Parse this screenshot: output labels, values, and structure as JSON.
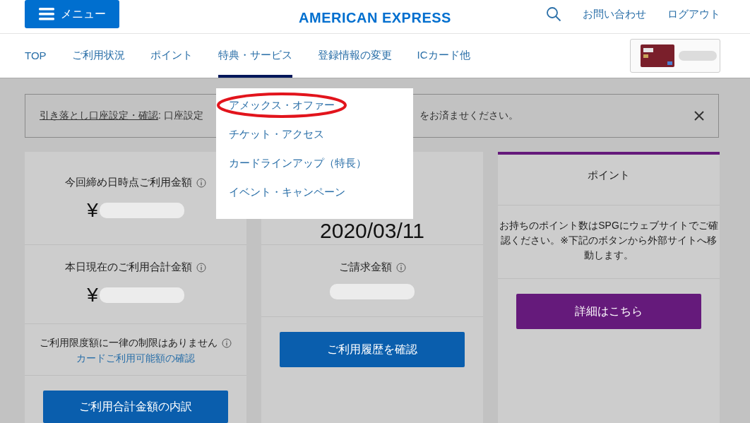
{
  "header": {
    "menu_button": "メニュー",
    "logo": "AMERICAN EXPRESS",
    "links": [
      "お問い合わせ",
      "ログアウト"
    ]
  },
  "nav": {
    "items": [
      {
        "label": "TOP",
        "selected": false
      },
      {
        "label": "ご利用状況",
        "selected": false
      },
      {
        "label": "ポイント",
        "selected": false
      },
      {
        "label": "特典・サービス",
        "selected": true
      },
      {
        "label": "登録情報の変更",
        "selected": false
      },
      {
        "label": "ICカード他",
        "selected": false
      }
    ]
  },
  "dropdown": {
    "items": [
      {
        "label": "アメックス・オファー",
        "circled": true
      },
      {
        "label": "チケット・アクセス",
        "circled": false
      },
      {
        "label": "カードラインアップ（特長）",
        "circled": false
      },
      {
        "label": "イベント・キャンペーン",
        "circled": false
      }
    ]
  },
  "alert": {
    "link": "引き落とし口座設定・確認",
    "text_left": ": 口座設定",
    "text_right": "をお済ませください。"
  },
  "cards": [
    {
      "accent": false,
      "sections": [
        {
          "kind": "amount",
          "title": "今回締め日時点ご利用金額",
          "currency": "¥"
        },
        {
          "kind": "amount",
          "title": "本日現在のご利用合計金額",
          "currency": "¥"
        },
        {
          "kind": "limit",
          "text": "ご利用限度額に一律の制限はありません",
          "link": "カードご利用可能額の確認"
        }
      ],
      "button": {
        "label": "ご利用合計金額の内訳",
        "color": "#0a5ead"
      }
    },
    {
      "accent": false,
      "sections": [
        {
          "kind": "date",
          "value": "2020/03/11"
        },
        {
          "kind": "amount",
          "title": "ご請求金額"
        }
      ],
      "button": {
        "label": "ご利用履歴を確認",
        "color": "#0a5ead"
      }
    },
    {
      "accent": true,
      "sections": [
        {
          "kind": "heading",
          "title": "ポイント"
        },
        {
          "kind": "note",
          "text": "お持ちのポイント数はSPGにウェブサイトでご確認ください。※下記のボタンから外部サイトへ移動します。"
        }
      ],
      "button": {
        "label": "詳細はこちら",
        "color": "#651a7b"
      }
    }
  ]
}
